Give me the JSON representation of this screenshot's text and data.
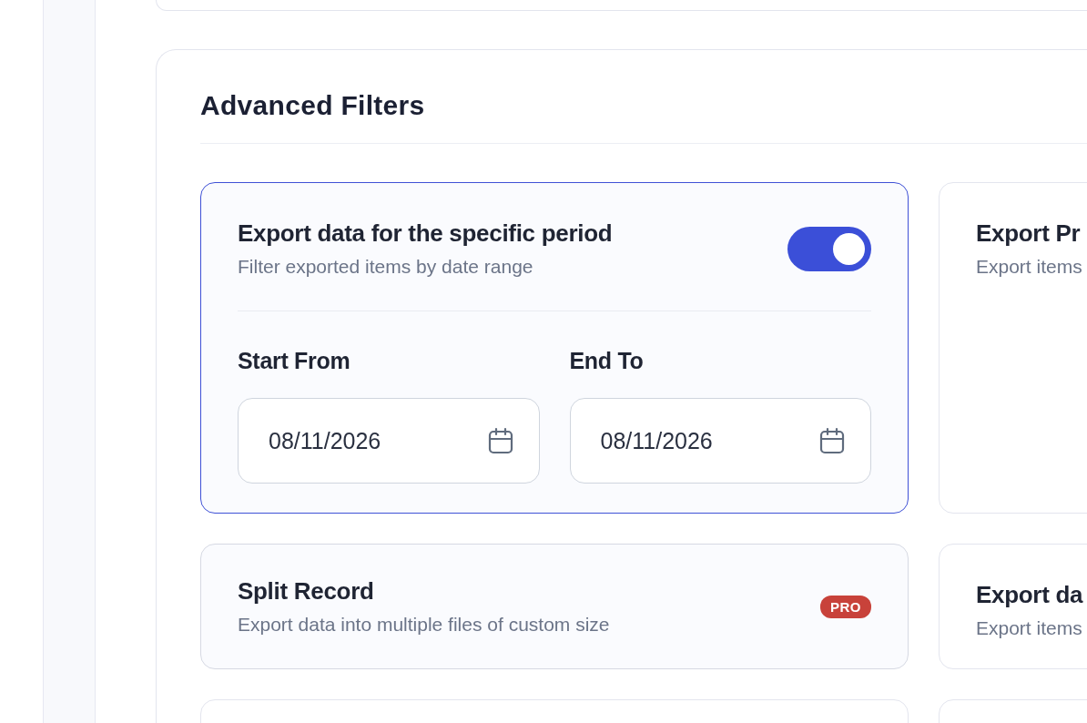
{
  "section": {
    "title": "Advanced Filters"
  },
  "cards": [
    {
      "kind": "period",
      "title": "Export data for the specific period",
      "subtitle": "Filter exported items by date range",
      "on": true,
      "fields": [
        {
          "label": "Start From",
          "value": "08/11/2026"
        },
        {
          "label": "End To",
          "value": "08/11/2026"
        }
      ]
    },
    {
      "kind": "option",
      "title": "Export Pr",
      "subtitle": "Export items"
    },
    {
      "kind": "pro",
      "title": "Split Record",
      "subtitle": "Export data into multiple files of custom size",
      "badge": "PRO"
    },
    {
      "kind": "option",
      "title": "Export da",
      "subtitle": "Export items"
    },
    {
      "kind": "blank"
    },
    {
      "kind": "blank"
    }
  ]
}
